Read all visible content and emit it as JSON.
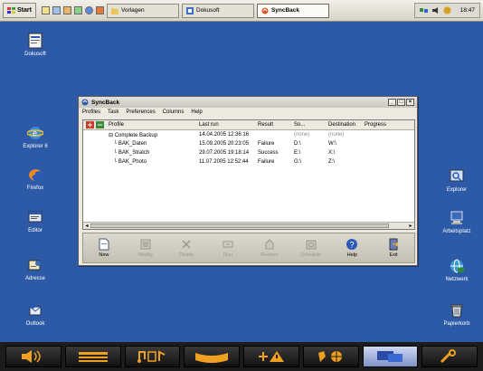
{
  "taskbar": {
    "start_label": "Start",
    "tasks": [
      {
        "label": "Vorlagen",
        "active": false
      },
      {
        "label": "Dokusoft",
        "active": false
      },
      {
        "label": "SyncBack",
        "active": true
      }
    ],
    "clock": "18:47"
  },
  "desktop": {
    "left_icons": [
      "Dokusoft",
      "Explorer 6",
      "Firefox",
      "Editor",
      "Adresse",
      "Outlook"
    ],
    "right_icons": [
      "Explorer",
      "Arbeitsplatz",
      "Netzwerk",
      "Papierkorb"
    ]
  },
  "window": {
    "title": "SyncBack",
    "menu": [
      "Profiles",
      "Task",
      "Preferences",
      "Columns",
      "Help"
    ],
    "columns": [
      "Profile",
      "Last run",
      "Result",
      "So...",
      "Destination",
      "Progress"
    ],
    "rows": [
      {
        "profile": "Complete Backup",
        "last_run": "14.04.2005 12:36:16",
        "result": "",
        "source": "(none)",
        "destination": "(none)",
        "progress": "",
        "group": true
      },
      {
        "profile": "BAK_Daten",
        "last_run": "15.09.2005 20:23:05",
        "result": "Failure",
        "source": "D:\\",
        "destination": "W:\\",
        "progress": "",
        "group": false
      },
      {
        "profile": "BAK_Stratch",
        "last_run": "29.07.2005 19:18:14",
        "result": "Success",
        "source": "E:\\",
        "destination": "X:\\",
        "progress": "",
        "group": false
      },
      {
        "profile": "BAK_Photo",
        "last_run": "11.07.2005 12:52:44",
        "result": "Failure",
        "source": "G:\\",
        "destination": "Z:\\",
        "progress": "",
        "group": false
      }
    ],
    "toolbar": [
      {
        "label": "New",
        "enabled": true
      },
      {
        "label": "Modify",
        "enabled": false
      },
      {
        "label": "Delete",
        "enabled": false
      },
      {
        "label": "Run",
        "enabled": false
      },
      {
        "label": "Restore",
        "enabled": false
      },
      {
        "label": "Schedule",
        "enabled": false
      },
      {
        "label": "Help",
        "enabled": true
      },
      {
        "label": "Exit",
        "enabled": true
      }
    ]
  },
  "colors": {
    "desktop": "#2d5aa6",
    "taskbar": "#e3e0d6",
    "bottombar": "#1c1c1c",
    "accent_orange": "#f0a020"
  }
}
